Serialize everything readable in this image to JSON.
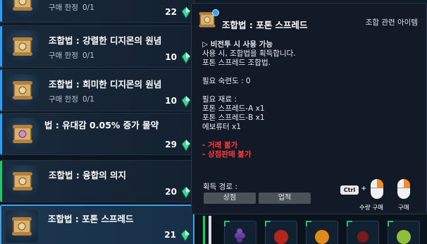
{
  "list": {
    "items": [
      {
        "title": "",
        "limit_label": "구매 한정",
        "limit_value": "0/1",
        "count": "22"
      },
      {
        "title": "조합법 : 강렬한 디지몬의 원념",
        "limit_label": "구매 한정",
        "limit_value": "0/1",
        "count": "10"
      },
      {
        "title": "조합법 : 희미한 디지몬의 원념",
        "limit_label": "구매 한정",
        "limit_value": "0/1",
        "count": "10"
      },
      {
        "title": "법 : 유대감 0.05% 증가 물약",
        "limit_label": "",
        "limit_value": "",
        "count": "29"
      },
      {
        "title": "조합법 : 융합의 의지",
        "limit_label": "",
        "limit_value": "",
        "count": "20"
      },
      {
        "title": "조합법 : 포톤 스프레드",
        "limit_label": "",
        "limit_value": "",
        "count": "21"
      }
    ]
  },
  "tooltip": {
    "title": "조합법 : 포톤 스프레드",
    "category": "조합 관련 아이템",
    "usage_header": "▷ 비전투 시 사용 가능",
    "usage_desc_1": "사용 시, 조합법을 획득합니다.",
    "usage_desc_2": "포톤 스프레드 조합법.",
    "proficiency": "필요 숙련도 : 0",
    "materials_header": "필요 재료 :",
    "materials": [
      "포톤 스프레드-A x1",
      "포톤 스프레드-B x1",
      "에보류터 x1"
    ],
    "restriction_1": "- 거래 불가",
    "restriction_2": "- 상점판매 불가",
    "acquisition_label": "획득 경로 :",
    "acq_shop": "상점",
    "acq_achievement": "업적",
    "ctrl_key": "Ctrl",
    "plus": "+",
    "bulk_buy": "수량 구매",
    "buy": "구매"
  },
  "colors": {
    "accent_blue": "#3aa2ea",
    "accent_green": "#27c46b",
    "warning_red": "#ff3b3b",
    "mouse_orange": "#ff8a1e"
  }
}
